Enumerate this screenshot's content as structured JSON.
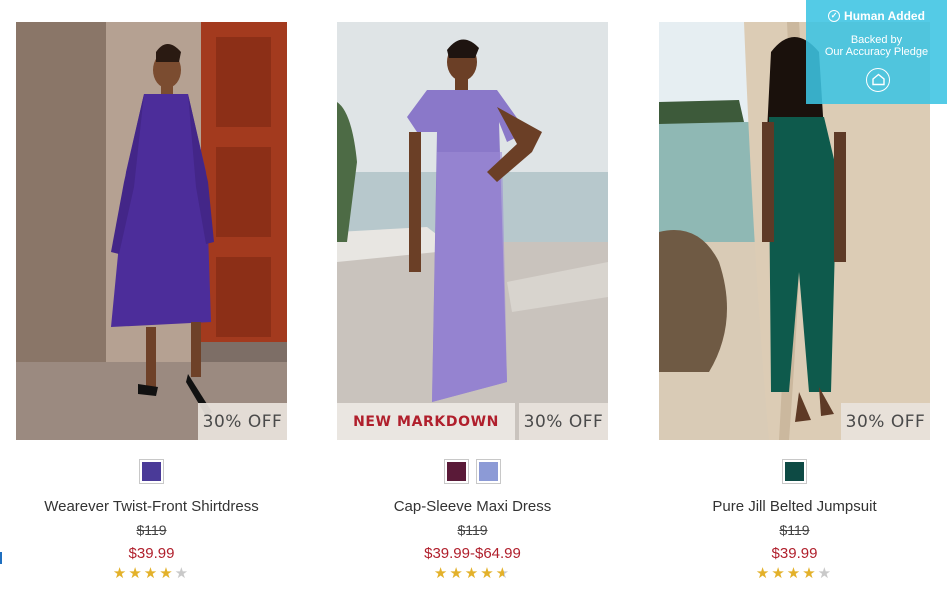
{
  "products": [
    {
      "name": "Wearever Twist-Front Shirtdress",
      "was_price": "$119",
      "price": "$39.99",
      "discount_badge": "30% OFF",
      "markdown_badge": "",
      "swatches": [
        "#4a3a98"
      ],
      "rating": 4,
      "rating_max": 5
    },
    {
      "name": "Cap-Sleeve Maxi Dress",
      "was_price": "$119",
      "price": "$39.99-$64.99",
      "discount_badge": "30% OFF",
      "markdown_badge": "NEW MARKDOWN",
      "swatches": [
        "#5a1a38",
        "#8c9ad6"
      ],
      "rating": 4.5,
      "rating_max": 5
    },
    {
      "name": "Pure Jill Belted Jumpsuit",
      "was_price": "$119",
      "price": "$39.99",
      "discount_badge": "30% OFF",
      "markdown_badge": "",
      "swatches": [
        "#0d4a44"
      ],
      "rating": 4,
      "rating_max": 5
    }
  ],
  "human_added": {
    "title": "Human Added",
    "subtitle_line1": "Backed by",
    "subtitle_line2": "Our Accuracy Pledge"
  },
  "colors": {
    "price_red": "#b01f2c",
    "star_gold": "#e3b12a",
    "star_gray": "#c9c9c9",
    "badge_bg": "#e8e2db",
    "human_box_bg": "#3cc4e2"
  },
  "icons": {
    "check": "check-circle-icon",
    "pledge": "home-shield-icon",
    "star": "star-icon"
  }
}
